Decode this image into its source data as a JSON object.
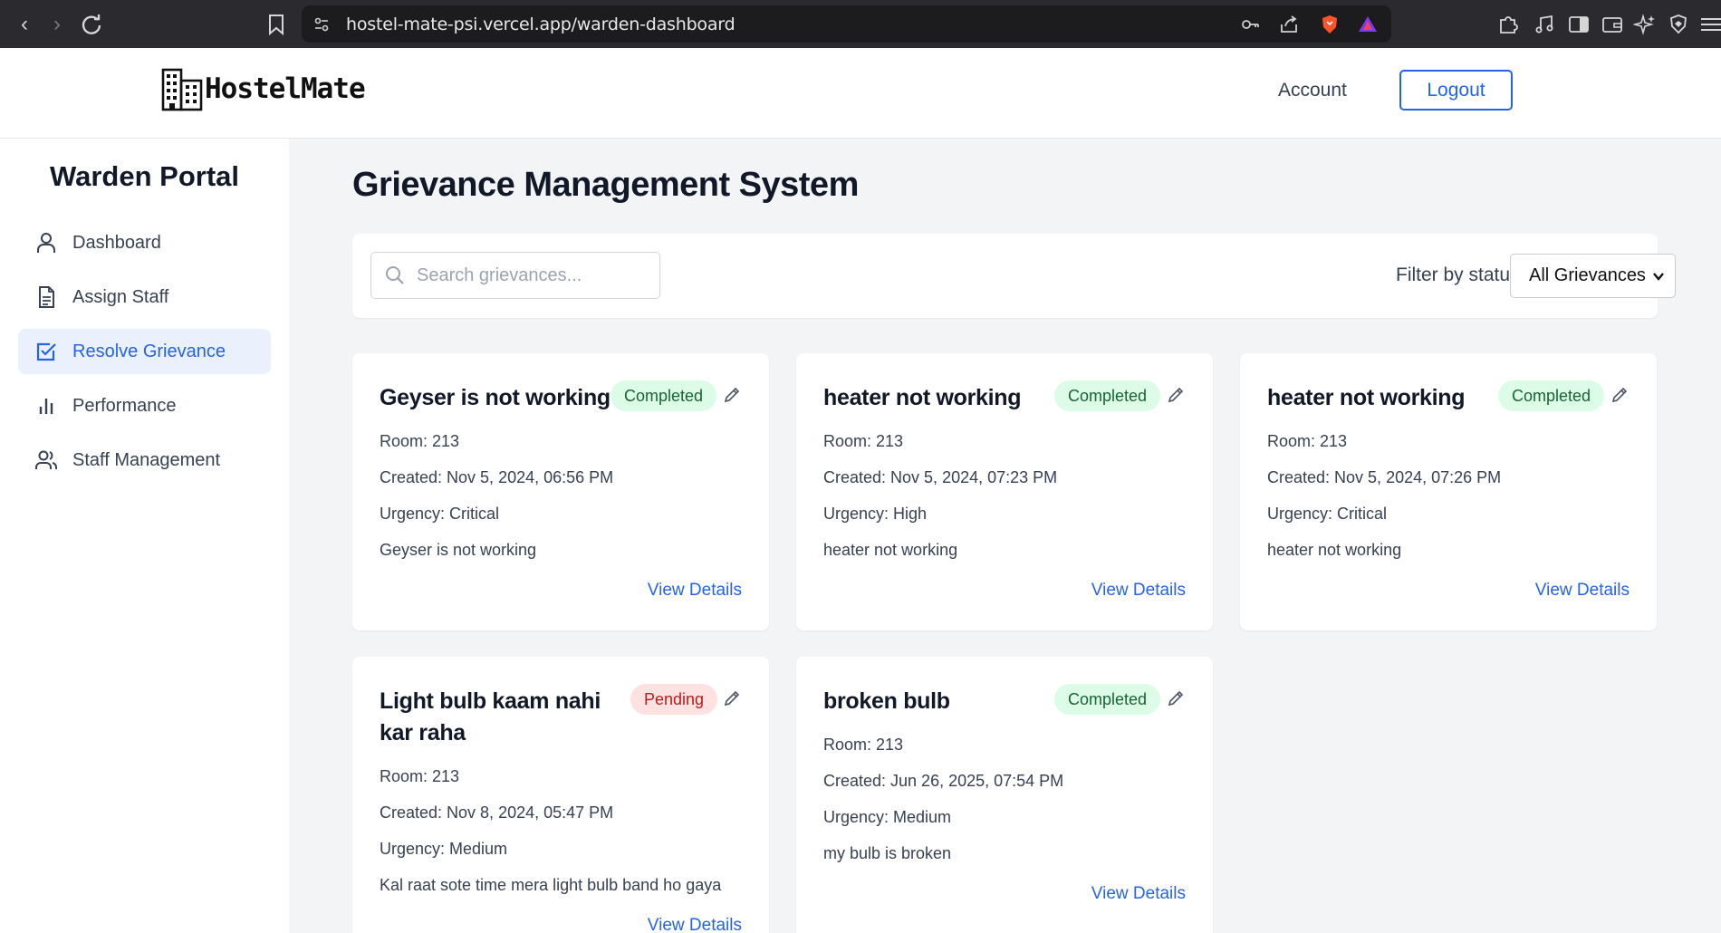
{
  "browser": {
    "url": "hostel-mate-psi.vercel.app/warden-dashboard"
  },
  "header": {
    "logo_text": "HostelMate",
    "account_label": "Account",
    "logout_label": "Logout"
  },
  "sidebar": {
    "title": "Warden Portal",
    "items": [
      {
        "label": "Dashboard",
        "icon": "user-icon",
        "active": false
      },
      {
        "label": "Assign Staff",
        "icon": "document-icon",
        "active": false
      },
      {
        "label": "Resolve Grievance",
        "icon": "checkbox-icon",
        "active": true
      },
      {
        "label": "Performance",
        "icon": "bar-chart-icon",
        "active": false
      },
      {
        "label": "Staff Management",
        "icon": "users-icon",
        "active": false
      }
    ]
  },
  "main": {
    "title": "Grievance Management System",
    "search_placeholder": "Search grievances...",
    "filter_label": "Filter by status:",
    "filter_value": "All Grievances",
    "view_details_label": "View Details",
    "grievances": [
      {
        "title": "Geyser is not working",
        "status": "Completed",
        "room": "Room: 213",
        "created": "Created: Nov 5, 2024, 06:56 PM",
        "urgency": "Urgency: Critical",
        "description": "Geyser is not working"
      },
      {
        "title": "heater not working",
        "status": "Completed",
        "room": "Room: 213",
        "created": "Created: Nov 5, 2024, 07:23 PM",
        "urgency": "Urgency: High",
        "description": "heater not working"
      },
      {
        "title": "heater not working",
        "status": "Completed",
        "room": "Room: 213",
        "created": "Created: Nov 5, 2024, 07:26 PM",
        "urgency": "Urgency: Critical",
        "description": "heater not working"
      },
      {
        "title": "Light bulb kaam nahi kar raha",
        "status": "Pending",
        "room": "Room: 213",
        "created": "Created: Nov 8, 2024, 05:47 PM",
        "urgency": "Urgency: Medium",
        "description": "Kal raat sote time mera light bulb band ho gaya"
      },
      {
        "title": "broken bulb",
        "status": "Completed",
        "room": "Room: 213",
        "created": "Created: Jun 26, 2025, 07:54 PM",
        "urgency": "Urgency: Medium",
        "description": "my bulb is broken"
      }
    ]
  },
  "colors": {
    "accent": "#2563eb",
    "completed_bg": "#dcfce7",
    "completed_text": "#166534",
    "pending_bg": "#fee2e2",
    "pending_text": "#b91c1c",
    "main_bg": "#f3f4f6"
  }
}
